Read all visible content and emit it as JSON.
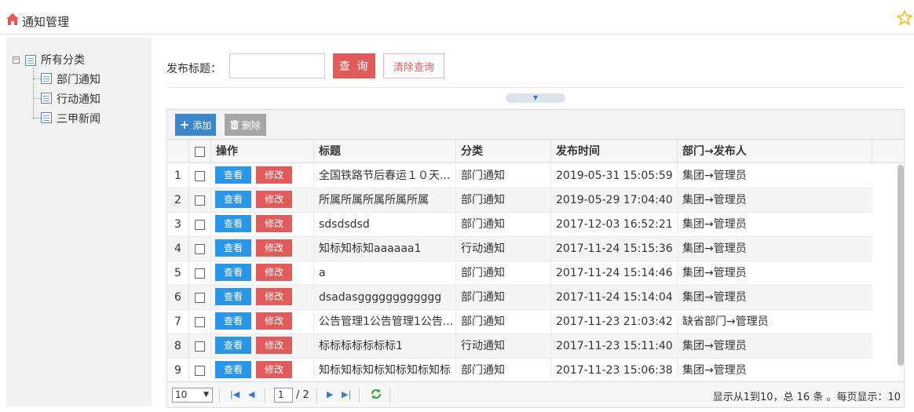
{
  "header": {
    "title": "通知管理"
  },
  "tree": {
    "root": "所有分类",
    "children": [
      "部门通知",
      "行动通知",
      "三甲新闻"
    ]
  },
  "search": {
    "label": "发布标题：",
    "value": "",
    "query_label": "查 询",
    "clear_label": "清除查询"
  },
  "toolbar": {
    "add_label": "添加",
    "delete_label": "删除"
  },
  "table": {
    "columns": [
      "操作",
      "标题",
      "分类",
      "发布时间",
      "部门→发布人"
    ],
    "view_label": "查看",
    "edit_label": "修改",
    "rows": [
      {
        "num": "1",
        "title": "全国铁路节后春运１０天...",
        "category": "部门通知",
        "time": "2019-05-31 15:05:59",
        "publisher": "集团→管理员"
      },
      {
        "num": "2",
        "title": "所属所属所属所属所属",
        "category": "部门通知",
        "time": "2019-05-29 17:04:40",
        "publisher": "集团→管理员"
      },
      {
        "num": "3",
        "title": "sdsdsdsd",
        "category": "部门通知",
        "time": "2017-12-03 16:52:21",
        "publisher": "集团→管理员"
      },
      {
        "num": "4",
        "title": "知标知标知aaaaaa1",
        "category": "行动通知",
        "time": "2017-11-24 15:15:36",
        "publisher": "集团→管理员"
      },
      {
        "num": "5",
        "title": "a",
        "category": "部门通知",
        "time": "2017-11-24 15:14:46",
        "publisher": "集团→管理员"
      },
      {
        "num": "6",
        "title": "dsadasgggggggggggg",
        "category": "部门通知",
        "time": "2017-11-24 15:14:04",
        "publisher": "集团→管理员"
      },
      {
        "num": "7",
        "title": "公告管理1公告管理1公告...",
        "category": "部门通知",
        "time": "2017-11-23 21:03:42",
        "publisher": "缺省部门→管理员"
      },
      {
        "num": "8",
        "title": "标标标标标标标1",
        "category": "行动通知",
        "time": "2017-11-23 15:11:40",
        "publisher": "集团→管理员"
      },
      {
        "num": "9",
        "title": "知标知标知标知标知标知标",
        "category": "部门通知",
        "time": "2017-11-23 15:06:38",
        "publisher": "集团→管理员"
      }
    ]
  },
  "pager": {
    "page_size": "10",
    "current_page": "1",
    "total_pages": "/ 2",
    "info": "显示从1到10，总 16 条 。每页显示：10"
  },
  "colors": {
    "accent_red": "#e25b5b",
    "view_blue": "#2996e8",
    "add_blue": "#3c87c9",
    "star": "#f0b400"
  }
}
